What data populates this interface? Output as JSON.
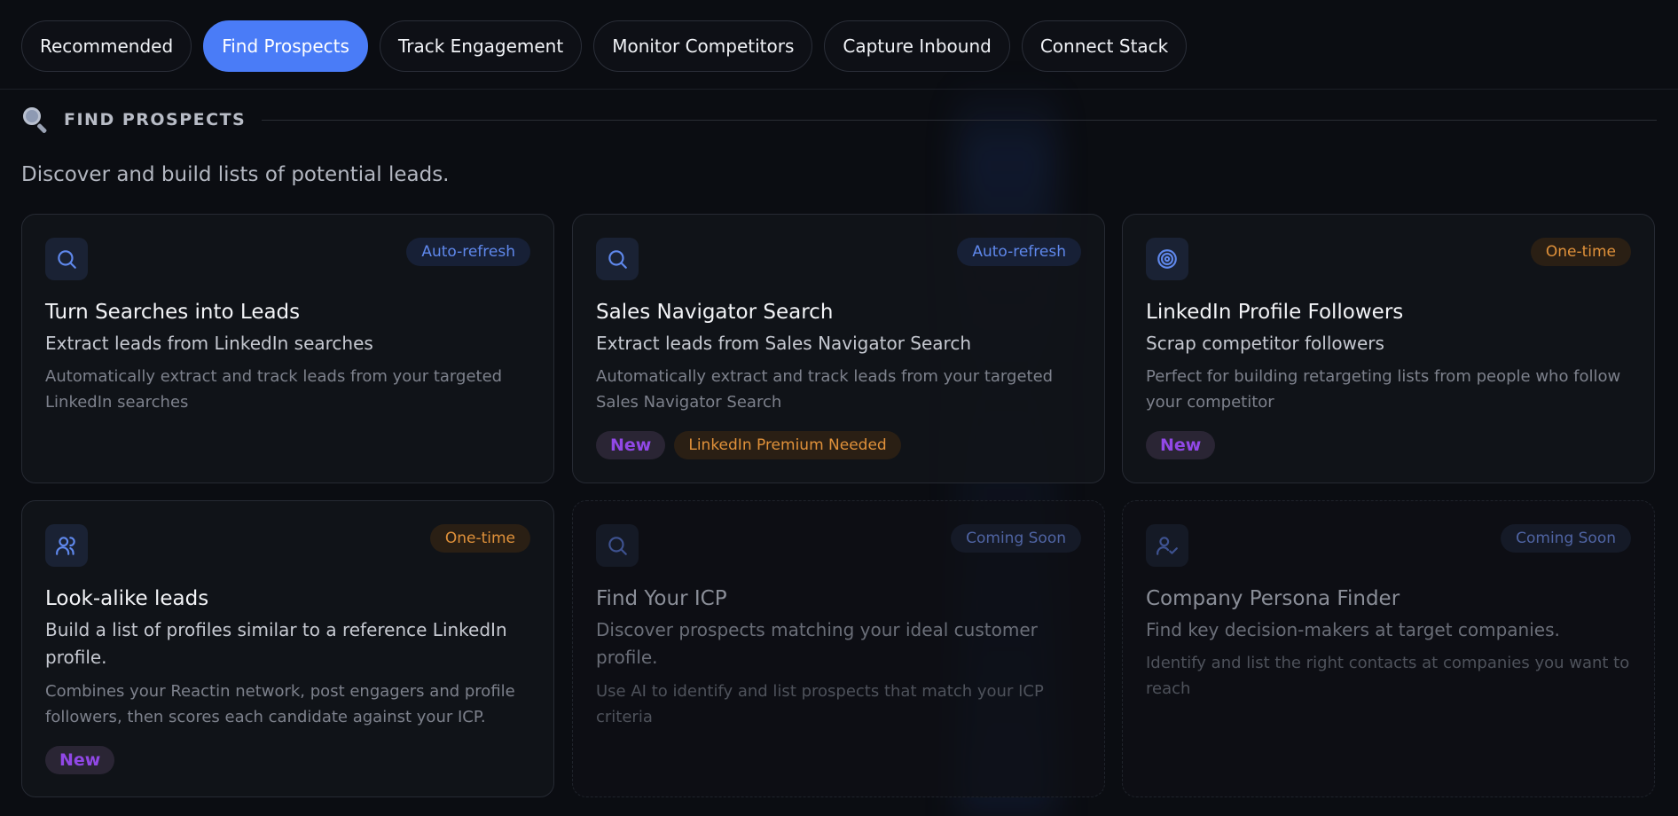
{
  "tabs": [
    {
      "label": "Recommended",
      "active": false
    },
    {
      "label": "Find Prospects",
      "active": true
    },
    {
      "label": "Track Engagement",
      "active": false
    },
    {
      "label": "Monitor Competitors",
      "active": false
    },
    {
      "label": "Capture Inbound",
      "active": false
    },
    {
      "label": "Connect Stack",
      "active": false
    }
  ],
  "section": {
    "icon": "magnifier-icon",
    "title": "FIND PROSPECTS",
    "description": "Discover and build lists of potential leads."
  },
  "cards": [
    {
      "icon": "search-icon",
      "badge": "Auto-refresh",
      "title": "Turn Searches into Leads",
      "subtitle": "Extract leads from LinkedIn searches",
      "description": "Automatically extract and track leads from your targeted LinkedIn searches",
      "tags": []
    },
    {
      "icon": "search-icon",
      "badge": "Auto-refresh",
      "title": "Sales Navigator Search",
      "subtitle": "Extract leads from Sales Navigator Search",
      "description": "Automatically extract and track leads from your targeted Sales Navigator Search",
      "tags": [
        "New",
        "LinkedIn Premium Needed"
      ]
    },
    {
      "icon": "target-icon",
      "badge": "One-time",
      "title": "LinkedIn Profile Followers",
      "subtitle": "Scrap competitor followers",
      "description": "Perfect for building retargeting lists from people who follow your competitor",
      "tags": [
        "New"
      ]
    },
    {
      "icon": "users-icon",
      "badge": "One-time",
      "title": "Look-alike leads",
      "subtitle": "Build a list of profiles similar to a reference LinkedIn profile.",
      "description": "Combines your Reactin network, post engagers and profile followers, then scores each candidate against your ICP.",
      "tags": [
        "New"
      ]
    },
    {
      "icon": "search-icon",
      "badge": "Coming Soon",
      "title": "Find Your ICP",
      "subtitle": "Discover prospects matching your ideal customer profile.",
      "description": "Use AI to identify and list prospects that match your ICP criteria",
      "tags": []
    },
    {
      "icon": "user-check-icon",
      "badge": "Coming Soon",
      "title": "Company Persona Finder",
      "subtitle": "Find key decision-makers at target companies.",
      "description": "Identify and list the right contacts at companies you want to reach",
      "tags": []
    }
  ],
  "colors": {
    "accent": "#4a7cf7",
    "auto_refresh": "#5f88ec",
    "one_time": "#e0913a",
    "new_tag": "#9148e6",
    "background": "#0b0d12"
  }
}
